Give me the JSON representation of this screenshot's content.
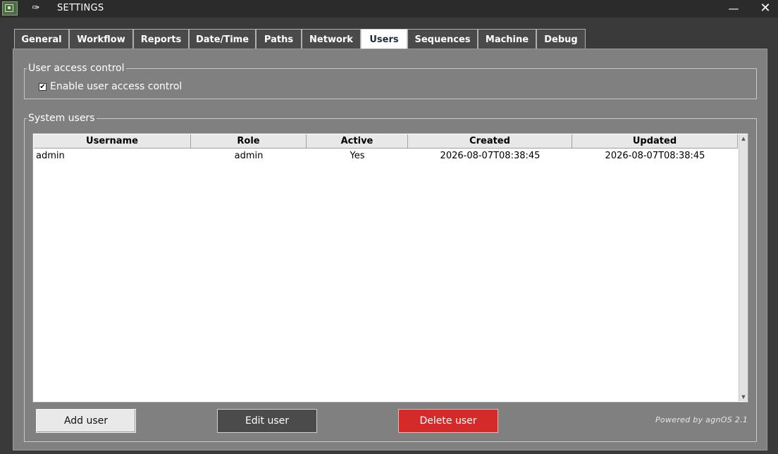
{
  "window": {
    "title": "SETTINGS",
    "minimize_glyph": "—",
    "close_glyph": "✕",
    "pin_glyph": "✑"
  },
  "tabs": [
    {
      "label": "General",
      "active": false
    },
    {
      "label": "Workflow",
      "active": false
    },
    {
      "label": "Reports",
      "active": false
    },
    {
      "label": "Date/Time",
      "active": false
    },
    {
      "label": "Paths",
      "active": false
    },
    {
      "label": "Network",
      "active": false
    },
    {
      "label": "Users",
      "active": true
    },
    {
      "label": "Sequences",
      "active": false
    },
    {
      "label": "Machine",
      "active": false
    },
    {
      "label": "Debug",
      "active": false
    }
  ],
  "access_control": {
    "group_title": "User access control",
    "checkbox_label": "Enable user access control",
    "checked": true,
    "check_glyph": "✔"
  },
  "users": {
    "group_title": "System users",
    "columns": [
      "Username",
      "Role",
      "Active",
      "Created",
      "Updated"
    ],
    "rows": [
      [
        "admin",
        "admin",
        "Yes",
        "2026-08-07T08:38:45",
        "2026-08-07T08:38:45"
      ]
    ],
    "scroll_up_glyph": "▲",
    "scroll_down_glyph": "▼"
  },
  "buttons": {
    "add": "Add user",
    "edit": "Edit user",
    "delete": "Delete user"
  },
  "footer": {
    "powered_by": "Powered by agnOS 2.1"
  },
  "colors": {
    "delete_button": "#d42a2a",
    "panel_background": "#808080",
    "active_tab": "#ffffff"
  }
}
